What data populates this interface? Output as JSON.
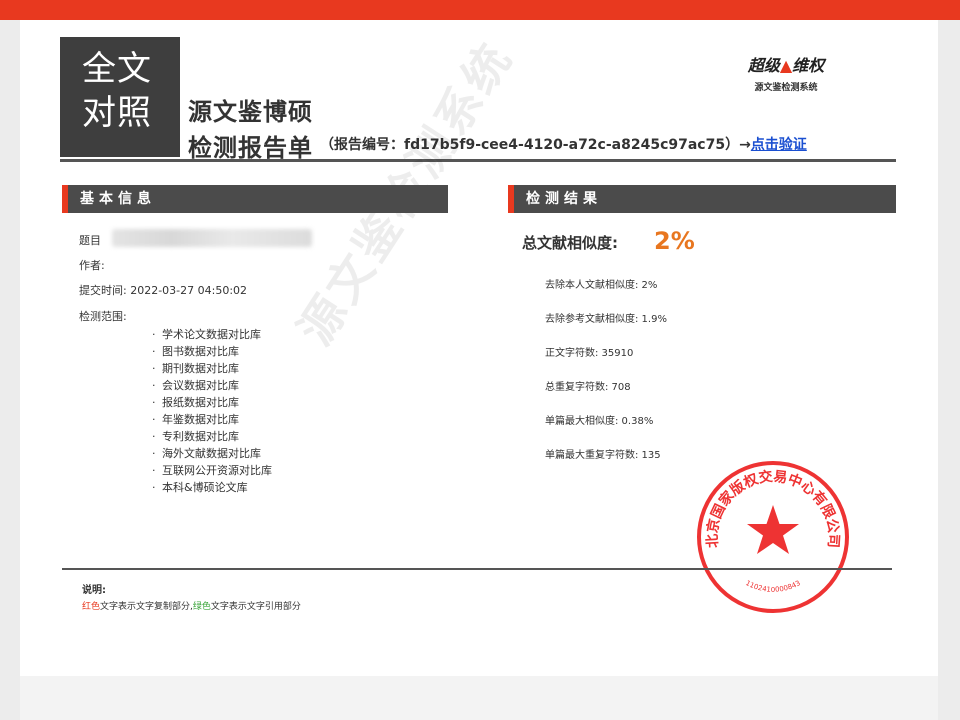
{
  "header": {
    "logo_lines": [
      "全文",
      "对照"
    ],
    "title_main": "源文鉴博硕",
    "title_sub": "检测报告单",
    "report_no_text": "（报告编号：fd17b5f9-cee4-4120-a72c-a8245c97ac75）→",
    "verify_link": "点击验证",
    "brand_name_left": "超级",
    "brand_name_right": "维权",
    "brand_sub": "源文鉴检测系统"
  },
  "basic_info": {
    "section_title": "基本信息",
    "title_label": "题目",
    "author_label": "作者:",
    "submit_time": "提交时间: 2022-03-27 04:50:02",
    "scope_label": "检测范围:",
    "scope_items": [
      "学术论文数据对比库",
      "图书数据对比库",
      "期刊数据对比库",
      "会议数据对比库",
      "报纸数据对比库",
      "年鉴数据对比库",
      "专利数据对比库",
      "海外文献数据对比库",
      "互联网公开资源对比库",
      "本科&博硕论文库"
    ]
  },
  "result": {
    "section_title": "检测结果",
    "total_label": "总文献相似度:",
    "total_value": "2%",
    "metrics": [
      "去除本人文献相似度: 2%",
      "去除参考文献相似度: 1.9%",
      "正文字符数: 35910",
      "总重复字符数: 708",
      "单篇最大相似度: 0.38%",
      "单篇最大重复字符数: 135"
    ]
  },
  "watermark": "源文鉴检测系统",
  "seal": {
    "text": "北京国家版权交易中心有限公司",
    "number": "1102410000843"
  },
  "footer": {
    "note_title": "说明:",
    "note_red": "红色",
    "note_mid": "文字表示文字复制部分,",
    "note_green": "绿色",
    "note_end": "文字表示文字引用部分"
  },
  "colors": {
    "accent_red": "#e8391f",
    "value_orange": "#e8761f",
    "section_dark": "#4b4b4b",
    "link_blue": "#1a4fd1"
  }
}
